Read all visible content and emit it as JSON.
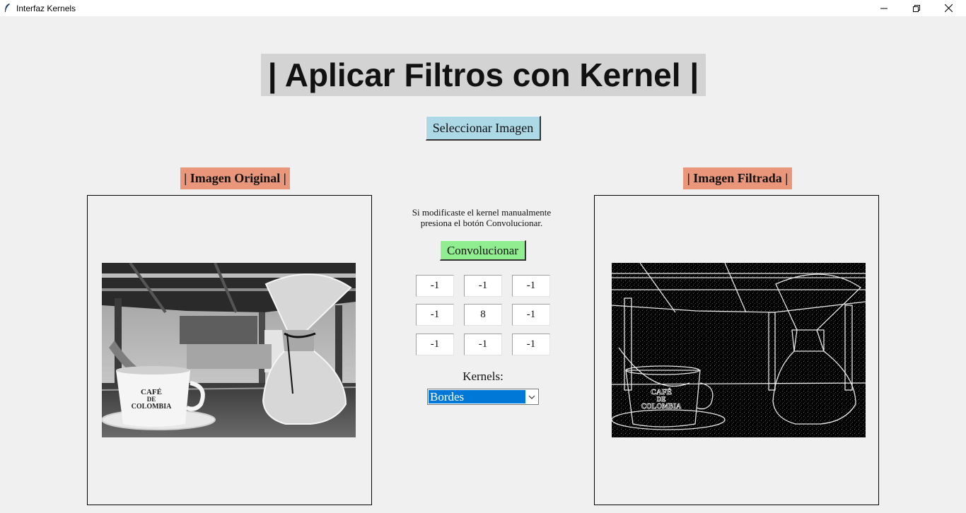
{
  "window": {
    "title": "Interfaz Kernels",
    "app_icon": "feather-icon",
    "controls": [
      "minimize-icon",
      "restore-icon",
      "close-icon"
    ]
  },
  "header": {
    "title": "| Aplicar Filtros con Kernel |"
  },
  "toolbar": {
    "select_image_label": "Seleccionar Imagen"
  },
  "panels": {
    "original_label": "| Imagen Original |",
    "filtered_label": "| Imagen Filtrada |"
  },
  "controls": {
    "hint_line1": "Si modificaste el kernel manualmente",
    "hint_line2": "presiona el botón Convolucionar.",
    "convolve_label": "Convolucionar",
    "kernel": [
      [
        "-1",
        "-1",
        "-1"
      ],
      [
        "-1",
        "8",
        "-1"
      ],
      [
        "-1",
        "-1",
        "-1"
      ]
    ],
    "kernels_label": "Kernels:",
    "kernel_selected": "Bordes"
  },
  "colors": {
    "title_bg": "#d3d3d3",
    "select_button_bg": "#add8e6",
    "panel_label_bg": "#e9967a",
    "convolve_button_bg": "#90ee90",
    "dropdown_highlight": "#0078d7"
  }
}
